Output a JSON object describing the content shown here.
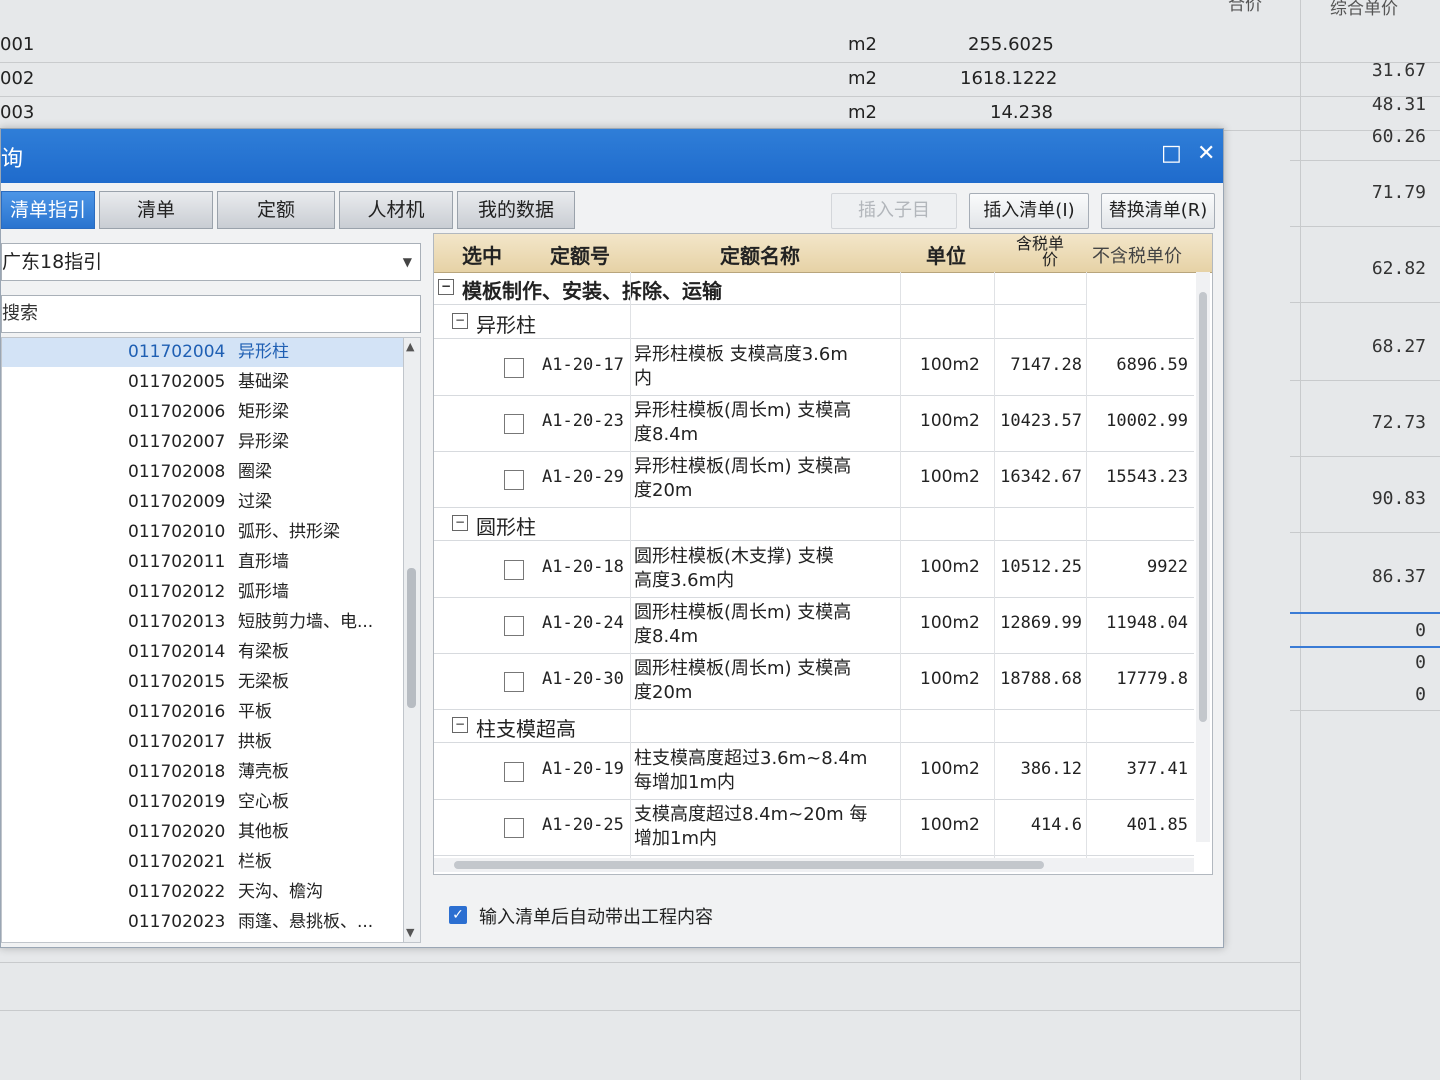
{
  "background": {
    "header_cols": [
      "合价",
      "综合单价"
    ],
    "rows": [
      {
        "code": "001",
        "unit": "m2",
        "qty": "255.6025"
      },
      {
        "code": "002",
        "unit": "m2",
        "qty": "1618.1222"
      },
      {
        "code": "003",
        "unit": "m2",
        "qty": "14.238"
      }
    ],
    "right_values": [
      "31.67",
      "48.31",
      "60.26",
      "71.79",
      "62.82",
      "68.27",
      "72.73",
      "90.83",
      "86.37",
      "0",
      "0",
      "0"
    ]
  },
  "dialog": {
    "title": "询",
    "maximize_icon": "□",
    "close_icon": "✕",
    "tabs": [
      "清单指引",
      "清单",
      "定额",
      "人材机",
      "我的数据"
    ],
    "buttons": {
      "insert_child": "插入子目",
      "insert_list": "插入清单(I)",
      "replace_list": "替换清单(R)"
    },
    "combo_value": "广东18指引",
    "search_placeholder": "搜索",
    "list": [
      {
        "code": "011702004",
        "name": "异形柱",
        "selected": true
      },
      {
        "code": "011702005",
        "name": "基础梁"
      },
      {
        "code": "011702006",
        "name": "矩形梁"
      },
      {
        "code": "011702007",
        "name": "异形梁"
      },
      {
        "code": "011702008",
        "name": "圈梁"
      },
      {
        "code": "011702009",
        "name": "过梁"
      },
      {
        "code": "011702010",
        "name": "弧形、拱形梁"
      },
      {
        "code": "011702011",
        "name": "直形墙"
      },
      {
        "code": "011702012",
        "name": "弧形墙"
      },
      {
        "code": "011702013",
        "name": "短肢剪力墙、电..."
      },
      {
        "code": "011702014",
        "name": "有梁板"
      },
      {
        "code": "011702015",
        "name": "无梁板"
      },
      {
        "code": "011702016",
        "name": "平板"
      },
      {
        "code": "011702017",
        "name": "拱板"
      },
      {
        "code": "011702018",
        "name": "薄壳板"
      },
      {
        "code": "011702019",
        "name": "空心板"
      },
      {
        "code": "011702020",
        "name": "其他板"
      },
      {
        "code": "011702021",
        "name": "栏板"
      },
      {
        "code": "011702022",
        "name": "天沟、檐沟"
      },
      {
        "code": "011702023",
        "name": "雨篷、悬挑板、..."
      }
    ],
    "grid": {
      "headers": {
        "select": "选中",
        "code": "定额号",
        "name": "定额名称",
        "unit": "单位",
        "tax_price_1": "含税单",
        "tax_price_2": "价",
        "notax_price": "不含税单价"
      },
      "root": "模板制作、安装、拆除、运输",
      "groups": [
        {
          "name": "异形柱",
          "items": [
            {
              "code": "A1-20-17",
              "name_1": "异形柱模板 支模高度3.6m",
              "name_2": "内",
              "unit": "100m2",
              "price_tax": "7147.28",
              "price_notax": "6896.59"
            },
            {
              "code": "A1-20-23",
              "name_1": "异形柱模板(周长m) 支模高",
              "name_2": "度8.4m",
              "unit": "100m2",
              "price_tax": "10423.57",
              "price_notax": "10002.99"
            },
            {
              "code": "A1-20-29",
              "name_1": "异形柱模板(周长m) 支模高",
              "name_2": "度20m",
              "unit": "100m2",
              "price_tax": "16342.67",
              "price_notax": "15543.23"
            }
          ]
        },
        {
          "name": "圆形柱",
          "items": [
            {
              "code": "A1-20-18",
              "name_1": "圆形柱模板(木支撑) 支模",
              "name_2": "高度3.6m内",
              "unit": "100m2",
              "price_tax": "10512.25",
              "price_notax": "9922"
            },
            {
              "code": "A1-20-24",
              "name_1": "圆形柱模板(周长m) 支模高",
              "name_2": "度8.4m",
              "unit": "100m2",
              "price_tax": "12869.99",
              "price_notax": "11948.04"
            },
            {
              "code": "A1-20-30",
              "name_1": "圆形柱模板(周长m) 支模高",
              "name_2": "度20m",
              "unit": "100m2",
              "price_tax": "18788.68",
              "price_notax": "17779.8"
            }
          ]
        },
        {
          "name": "柱支模超高",
          "items": [
            {
              "code": "A1-20-19",
              "name_1": "柱支模高度超过3.6m~8.4m",
              "name_2": "每增加1m内",
              "unit": "100m2",
              "price_tax": "386.12",
              "price_notax": "377.41"
            },
            {
              "code": "A1-20-25",
              "name_1": "支模高度超过8.4m~20m 每",
              "name_2": "增加1m内",
              "unit": "100m2",
              "price_tax": "414.6",
              "price_notax": "401.85"
            }
          ]
        }
      ]
    },
    "auto_option": {
      "checked": true,
      "label": "输入清单后自动带出工程内容"
    }
  }
}
